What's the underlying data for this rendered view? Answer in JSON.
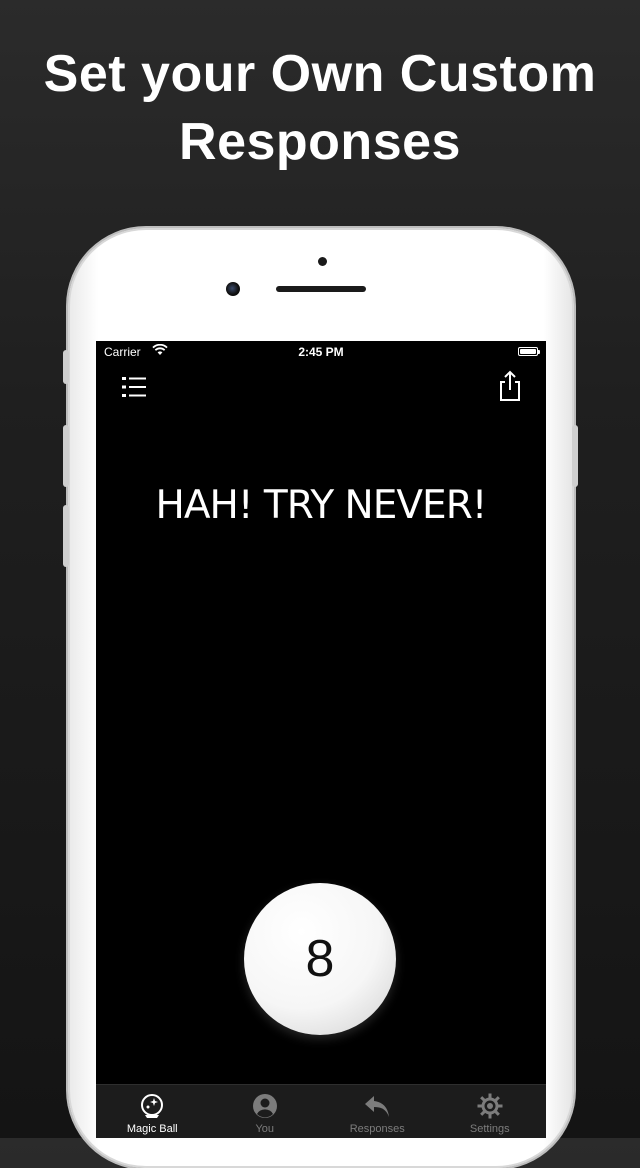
{
  "headline": {
    "line1": "Set your Own Custom",
    "line2": "Responses"
  },
  "status_bar": {
    "carrier": "Carrier",
    "time": "2:45 PM",
    "wifi_icon": "wifi-icon",
    "battery_icon": "battery-icon"
  },
  "toolbar": {
    "menu_icon": "list-icon",
    "share_icon": "share-icon"
  },
  "answer_text": "HAH! TRY NEVER!",
  "ball": {
    "number": "8"
  },
  "tabs": [
    {
      "label": "Magic Ball",
      "icon": "magic-ball-icon",
      "active": true
    },
    {
      "label": "You",
      "icon": "person-icon",
      "active": false
    },
    {
      "label": "Responses",
      "icon": "reply-arrow-icon",
      "active": false
    },
    {
      "label": "Settings",
      "icon": "gear-icon",
      "active": false
    }
  ],
  "colors": {
    "background": "#1f1f1f",
    "screen": "#000000",
    "tab_active": "#ffffff",
    "tab_inactive": "#7c7c7c"
  }
}
